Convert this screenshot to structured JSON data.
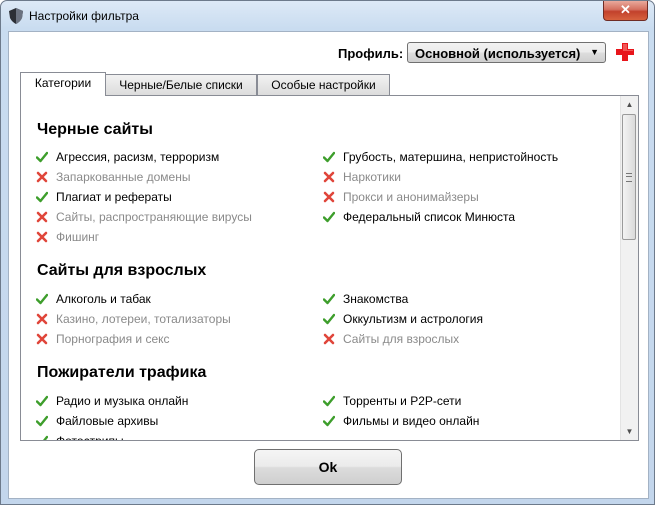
{
  "window": {
    "title": "Настройки фильтра",
    "close_glyph": "✕"
  },
  "profile": {
    "label": "Профиль:",
    "value": "Основной (используется)",
    "arrow": "▼"
  },
  "tabs": [
    {
      "label": "Категории",
      "active": true
    },
    {
      "label": "Черные/Белые списки",
      "active": false
    },
    {
      "label": "Особые настройки",
      "active": false
    }
  ],
  "sections": [
    {
      "title": "Черные сайты",
      "left": [
        {
          "label": "Агрессия, расизм, терроризм",
          "enabled": true
        },
        {
          "label": "Запаркованные домены",
          "enabled": false
        },
        {
          "label": "Плагиат и рефераты",
          "enabled": true
        },
        {
          "label": "Сайты, распространяющие вирусы",
          "enabled": false
        },
        {
          "label": "Фишинг",
          "enabled": false
        }
      ],
      "right": [
        {
          "label": "Грубость, матершина, непристойность",
          "enabled": true
        },
        {
          "label": "Наркотики",
          "enabled": false
        },
        {
          "label": "Прокси и анонимайзеры",
          "enabled": false
        },
        {
          "label": "Федеральный список Минюста",
          "enabled": true
        }
      ]
    },
    {
      "title": "Сайты для взрослых",
      "left": [
        {
          "label": "Алкоголь и табак",
          "enabled": true
        },
        {
          "label": "Казино, лотереи, тотализаторы",
          "enabled": false
        },
        {
          "label": "Порнография и секс",
          "enabled": false
        }
      ],
      "right": [
        {
          "label": "Знакомства",
          "enabled": true
        },
        {
          "label": "Оккультизм и астрология",
          "enabled": true
        },
        {
          "label": "Сайты для взрослых",
          "enabled": false
        }
      ]
    },
    {
      "title": "Пожиратели трафика",
      "left": [
        {
          "label": "Радио и музыка онлайн",
          "enabled": true
        },
        {
          "label": "Файловые архивы",
          "enabled": true
        },
        {
          "label": "Фотострипы",
          "enabled": true
        }
      ],
      "right": [
        {
          "label": "Торренты и P2P-сети",
          "enabled": true
        },
        {
          "label": "Фильмы и видео онлайн",
          "enabled": true
        }
      ]
    }
  ],
  "ok_button": {
    "label": "Ok"
  },
  "colors": {
    "enabled_icon": "#3e9e2c",
    "disabled_icon": "#e0453a",
    "disabled_text": "#8a8a8a",
    "add_icon": "#e8151b"
  },
  "icons": {
    "app": "shield-icon",
    "add": "plus-icon",
    "enabled": "check-icon",
    "disabled": "cross-icon"
  }
}
